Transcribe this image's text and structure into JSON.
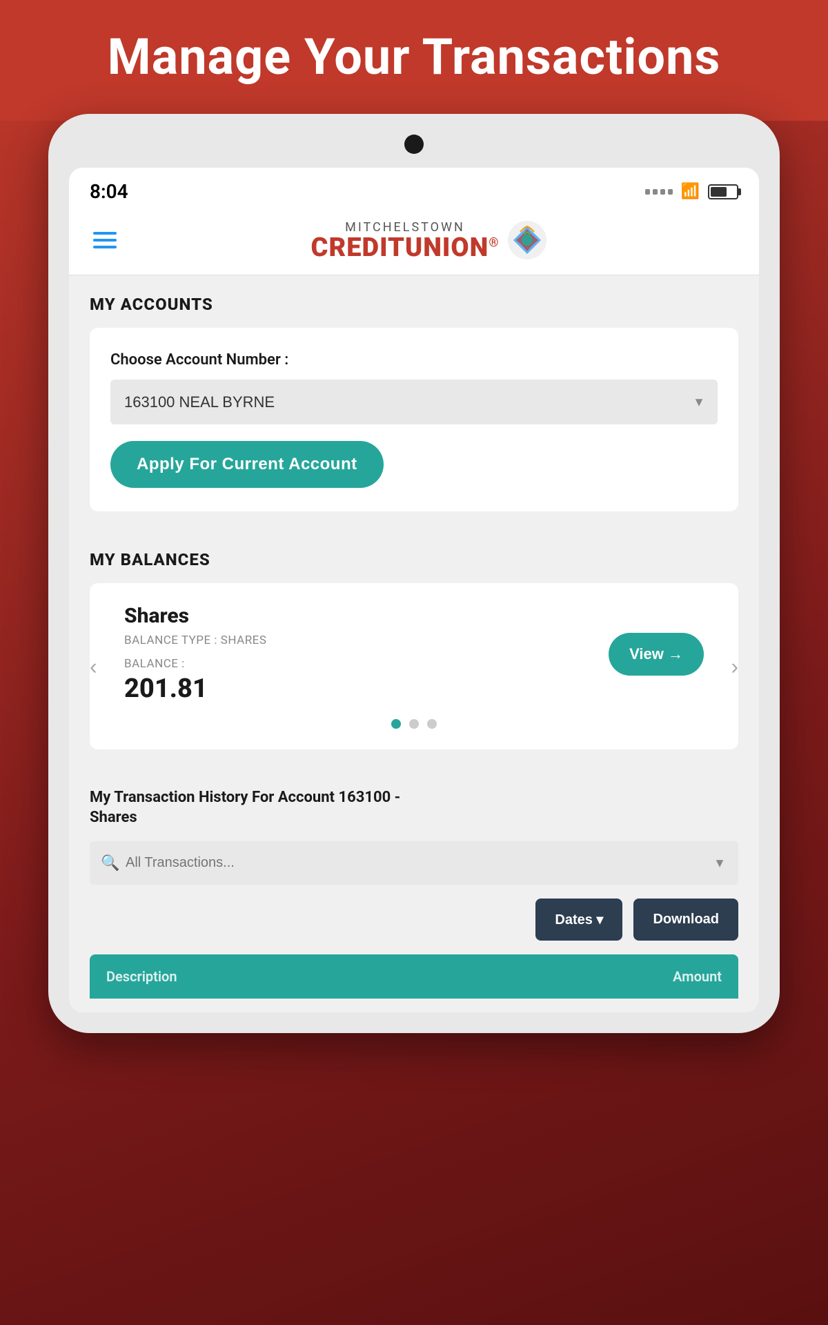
{
  "banner": {
    "title": "Manage Your Transactions"
  },
  "statusBar": {
    "time": "8:04",
    "battery": "65"
  },
  "logo": {
    "mitchelstown": "MITCHELSTOWN",
    "creditUnion": "CREDITUNION",
    "suffix": "®"
  },
  "myAccounts": {
    "sectionTitle": "MY ACCOUNTS",
    "chooseLabel": "Choose Account Number :",
    "accountValue": "163100 NEAL BYRNE",
    "applyButtonLabel": "Apply For Current Account"
  },
  "myBalances": {
    "sectionTitle": "MY BALANCES",
    "balanceTitle": "Shares",
    "balanceTypeLabel": "BALANCE TYPE : SHARES",
    "balanceLabel": "BALANCE :",
    "balanceAmount": "201.81",
    "viewButtonLabel": "View →",
    "carouselDots": [
      true,
      false,
      false
    ]
  },
  "transactionHistory": {
    "titleLine1": "My Transaction History For Account 163100 -",
    "titleLine2": "Shares",
    "searchPlaceholder": "All Transactions...",
    "datesLabel": "Dates ▾",
    "downloadLabel": "Download",
    "tableHeaderDescription": "Description",
    "tableHeaderAmount": "Amount"
  }
}
